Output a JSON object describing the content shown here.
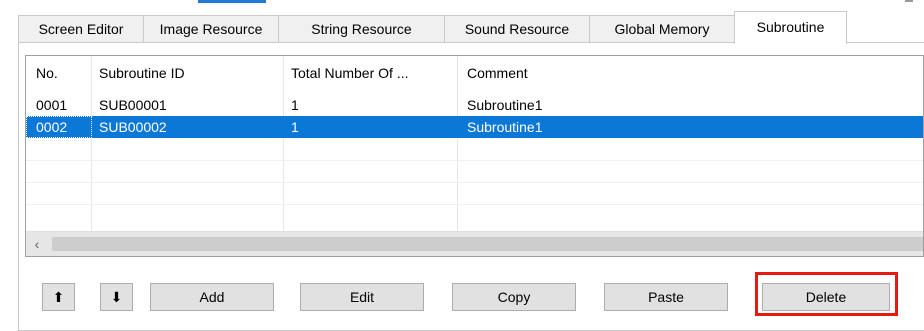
{
  "tabs": [
    {
      "label": "Screen Editor",
      "active": false
    },
    {
      "label": "Image Resource",
      "active": false
    },
    {
      "label": "String Resource",
      "active": false
    },
    {
      "label": "Sound Resource",
      "active": false
    },
    {
      "label": "Global Memory",
      "active": false
    },
    {
      "label": "Subroutine",
      "active": true
    }
  ],
  "list": {
    "columns": [
      "No.",
      "Subroutine ID",
      "Total Number Of ...",
      "Comment"
    ],
    "rows": [
      {
        "no": "0001",
        "id": "SUB00001",
        "total": "1",
        "comment": "Subroutine1",
        "selected": false
      },
      {
        "no": "0002",
        "id": "SUB00002",
        "total": "1",
        "comment": "Subroutine1",
        "selected": true
      }
    ],
    "scroll_left_icon": "chevron-left-icon"
  },
  "buttons": {
    "move_up": "arrow-up-icon",
    "move_down": "arrow-down-icon",
    "add": "Add",
    "edit": "Edit",
    "copy": "Copy",
    "paste": "Paste",
    "delete": "Delete"
  },
  "colors": {
    "selection": "#0b78d7",
    "highlight_box": "#e8190f"
  }
}
